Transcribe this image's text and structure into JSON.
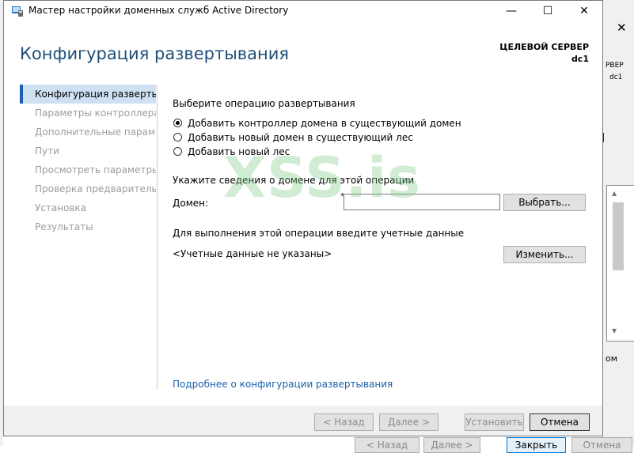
{
  "window": {
    "title": "Мастер настройки доменных служб Active Directory",
    "minimize_glyph": "—",
    "maximize_glyph": "☐",
    "close_glyph": "✕"
  },
  "header": {
    "page_title": "Конфигурация развертывания",
    "target_label": "ЦЕЛЕВОЙ СЕРВЕР",
    "target_name": "dc1"
  },
  "nav": {
    "items": [
      {
        "label": "Конфигурация развертыв..."
      },
      {
        "label": "Параметры контроллера..."
      },
      {
        "label": "Дополнительные парам..."
      },
      {
        "label": "Пути"
      },
      {
        "label": "Просмотреть параметры"
      },
      {
        "label": "Проверка предваритель..."
      },
      {
        "label": "Установка"
      },
      {
        "label": "Результаты"
      }
    ],
    "active_index": 0
  },
  "main": {
    "operation_heading": "Выберите операцию развертывания",
    "options": [
      {
        "label": "Добавить контроллер домена в существующий домен",
        "selected": true
      },
      {
        "label": "Добавить новый домен в существующий лес",
        "selected": false
      },
      {
        "label": "Добавить новый лес",
        "selected": false
      }
    ],
    "domain_info_heading": "Укажите сведения о домене для этой операции",
    "domain_label": "Домен:",
    "domain_required_mark": "*",
    "domain_value": "",
    "select_button": "Выбрать...",
    "credentials_heading": "Для выполнения этой операции введите учетные данные",
    "credentials_status": "<Учетные данные не указаны>",
    "change_button": "Изменить...",
    "more_link": "Подробнее о конфигурации развертывания"
  },
  "footer": {
    "back": "< Назад",
    "next": "Далее >",
    "install": "Установить",
    "cancel": "Отмена"
  },
  "background_window": {
    "close_glyph": "✕",
    "text1": "РВЕР",
    "text2": "dc1",
    "text3": "ом",
    "buttons": {
      "back": "< Назад",
      "next": "Далее >",
      "close": "Закрыть",
      "cancel": "Отмена"
    }
  },
  "watermark": "XSS.is",
  "colors": {
    "title_blue": "#1e4e79",
    "nav_active_bg": "#cfe0f3",
    "link": "#1a5fa8"
  }
}
